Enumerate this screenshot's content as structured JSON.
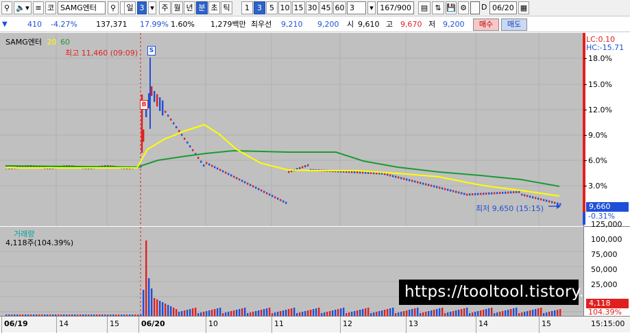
{
  "toolbar": {
    "market": "코",
    "stock_name": "SAMG엔터",
    "period_day": "일",
    "period_num": "3",
    "tabs": [
      "주",
      "월",
      "년",
      "분",
      "초",
      "틱"
    ],
    "active_tab": "분",
    "intervals": [
      "1",
      "3",
      "5",
      "10",
      "15",
      "30",
      "45",
      "60"
    ],
    "active_interval": "3",
    "interval_value": "3",
    "count": "167/900",
    "checkbox_label": "D",
    "date": "06/20"
  },
  "quote": {
    "change": "410",
    "change_pct": "-4.27%",
    "volume": "137,371",
    "pct2": "17.99%",
    "pct3": "1.60%",
    "amount": "1,279백만",
    "best_label": "최우선",
    "best_ask": "9,210",
    "best_bid": "9,200",
    "open_label": "시",
    "open": "9,610",
    "high_label": "고",
    "high": "9,670",
    "low_label": "저",
    "low": "9,200",
    "buy_label": "매수",
    "sell_label": "매도"
  },
  "chart": {
    "title": "SAMG엔터",
    "ma_labels": [
      "20",
      "60"
    ],
    "high_annotation": "최고 11,460 (09:09)",
    "low_annotation": "최저 9,650 (15:15)",
    "marker_s": "S",
    "marker_b": "B",
    "lc": "LC:0.10",
    "hc": "HC:-15.71",
    "price_box": "9,660",
    "price_pct": "-0.31%",
    "volume_title": "거래량",
    "volume_info": "4,118주(104.39%)",
    "volume_box": "4,118",
    "volume_pct": "104.39%",
    "clock": "15:15:00",
    "watermark": "https://tooltool.tistory.com"
  },
  "colors": {
    "up": "#e02020",
    "down": "#1f4fd8",
    "ma20": "#ffff00",
    "ma60": "#1a9a30",
    "panel": "#c0c0c0"
  },
  "chart_data": [
    {
      "type": "candlestick",
      "title": "SAMG엔터",
      "x_tick_labels": [
        "06/19",
        "14",
        "15",
        "06/20",
        "10",
        "11",
        "12",
        "13",
        "14",
        "15"
      ],
      "y_tick_labels": [
        "3.0%",
        "6.0%",
        "9.0%",
        "12.0%",
        "15.0%",
        "18.0%"
      ],
      "y_unit": "% change",
      "series": [
        {
          "name": "20",
          "type": "line"
        },
        {
          "name": "60",
          "type": "line"
        }
      ]
    },
    {
      "type": "bar",
      "title": "거래량",
      "y_tick_labels": [
        "25,000",
        "50,000",
        "75,000",
        "100,000",
        "125,000"
      ]
    }
  ]
}
